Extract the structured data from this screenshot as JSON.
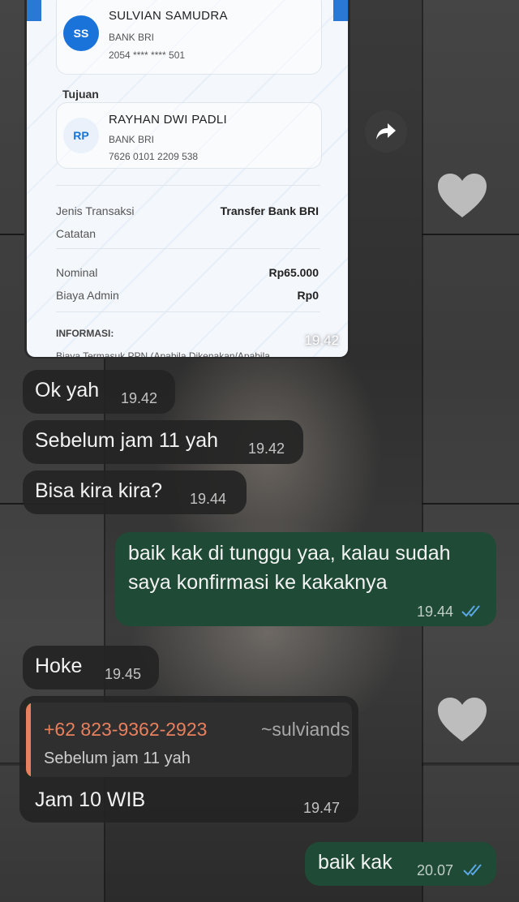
{
  "receipt": {
    "sender": {
      "initials": "SS",
      "name": "SULVIAN SAMUDRA",
      "bank": "BANK BRI",
      "account": "2054 **** **** 501"
    },
    "destination_label": "Tujuan",
    "receiver": {
      "initials": "RP",
      "name": "RAYHAN DWI PADLI",
      "bank": "BANK BRI",
      "account": "7626 0101 2209 538"
    },
    "rows": [
      {
        "label": "Jenis Transaksi",
        "value": "Transfer Bank BRI"
      },
      {
        "label": "Catatan",
        "value": ""
      },
      {
        "label": "Nominal",
        "value": "Rp65.000"
      },
      {
        "label": "Biaya Admin",
        "value": "Rp0"
      }
    ],
    "info_label": "INFORMASI:",
    "info_text": "Biaya Termasuk PPN (Apabila Dikenakan/Apabila",
    "time": "19.42",
    "accent": "#1a73d9"
  },
  "messages": [
    {
      "dir": "in",
      "text": "Ok yah",
      "time": "19.42"
    },
    {
      "dir": "in",
      "text": "Sebelum jam 11 yah",
      "time": "19.42"
    },
    {
      "dir": "in",
      "text": "Bisa kira kira?",
      "time": "19.44"
    },
    {
      "dir": "out",
      "line1": "baik kak di tunggu yaa, kalau sudah",
      "line2": "saya konfirmasi ke kakaknya",
      "time": "19.44"
    },
    {
      "dir": "in",
      "text": "Hoke",
      "time": "19.45"
    },
    {
      "dir": "in",
      "reply": {
        "name": "+62 823-9362-2923",
        "alias": "~sulviands",
        "text": "Sebelum jam 11 yah"
      },
      "text": "Jam 10 WIB",
      "time": "19.47"
    },
    {
      "dir": "out",
      "text": "baik kak",
      "time": "20.07"
    }
  ],
  "icons": {
    "share": "forward-arrow-icon",
    "reaction": "heart-icon",
    "read": "double-check-icon"
  },
  "colors": {
    "incoming": "#242424",
    "outgoing": "#1f4a35",
    "quote_name": "#e9805d",
    "read_tick": "#5aa9e6"
  }
}
